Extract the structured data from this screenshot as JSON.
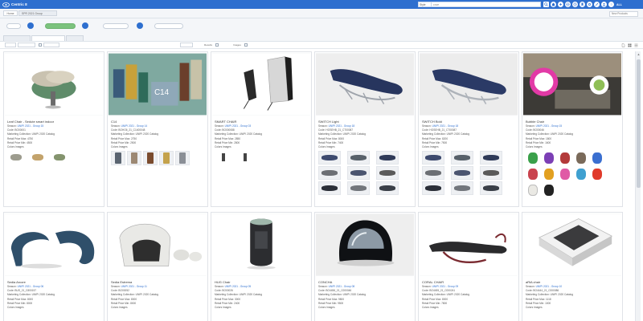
{
  "app": {
    "title": "Centric 8"
  },
  "header": {
    "style_select": "Style",
    "search_value": "cove",
    "all_label": "ALL"
  },
  "tabs": {
    "home": "Home",
    "crumb": "SPR 2021 Group"
  },
  "sub_search_placeholder": "New Products",
  "actions": {
    "pill1": "",
    "pill2": "",
    "pill3": ""
  },
  "view_tabs": [
    "",
    "",
    ""
  ],
  "filter": {
    "sel1": "",
    "sel2": "",
    "sel3": "",
    "sel4": "",
    "label_results": "Results",
    "label_images": "Images"
  },
  "cards": [
    {
      "title": "Leaf Chair - Sedute smart indoor",
      "season": "UNIPI 2021 - Group 15",
      "code": "BO00001",
      "marketing": "UNIPI 2020 Catalog",
      "price_max": "4750",
      "price_min": "4500",
      "thumbs_label": "Colors Images"
    },
    {
      "title": "C14",
      "season": "UNIPI 2021 - Group 14",
      "code": "BOHO6_21_C1400048",
      "marketing": "UNIPI 2020 Catalog",
      "price_max": "2750",
      "price_min": "2500",
      "thumbs_label": "Colors Images"
    },
    {
      "title": "SMART CHAIR",
      "season": "UNIPI 2021 - Group 03",
      "code": "BO000088",
      "marketing": "UNIPI 2020 Catalog",
      "price_max": "2850",
      "price_min": "2800",
      "thumbs_label": "Colors Images"
    },
    {
      "title": "SWITCH Light",
      "season": "UNIPI 2021 - Group 18",
      "code": "HOSEHB_21_CT00087",
      "marketing": "UNIPI 2020 Catalog",
      "price_max": "8000",
      "price_min": "7400",
      "thumbs_label": "Colors Images"
    },
    {
      "title": "SWITCH Bold",
      "season": "UNIPI 2021 - Group 18",
      "code": "HOSEHB_21_CT00087",
      "marketing": "UNIPI 2020 Catalog",
      "price_max": "8200",
      "price_min": "7500",
      "thumbs_label": "Colors Images"
    },
    {
      "title": "Bubble Chair",
      "season": "UNIPI 2021 - Group 15",
      "code": "BO00046",
      "marketing": "UNIPI 2020 Catalog",
      "price_max": "1800",
      "price_min": "1600",
      "thumbs_label": "Colors Images"
    },
    {
      "title": "Sedia Arcore",
      "season": "UNIPI 2021 - Group 06",
      "code": "BUS_21_C800157",
      "marketing": "UNIPI 2020 Catalog",
      "price_max": "8000",
      "price_min": "8000",
      "thumbs_label": "Colors Images"
    },
    {
      "title": "Sedia Estrema",
      "season": "UNIPI 2021 - Group 11",
      "code": "BO00052",
      "marketing": "UNIPI 2020 Catalog",
      "price_max": "8000",
      "price_min": "8000",
      "thumbs_label": "Colors Images"
    },
    {
      "title": "HUG Chair",
      "season": "UNIPI 2021 - Group 05",
      "code": "BO00026",
      "marketing": "UNIPI 2020 Catalog",
      "price_max": "3000",
      "price_min": "2400",
      "thumbs_label": "Colors Images"
    },
    {
      "title": "CONCHA",
      "season": "UNIPI 2021 - Group 08",
      "code": "BO4456_21_C000046",
      "marketing": "UNIPI 2020 Catalog",
      "price_max": "9800",
      "price_min": "9500",
      "thumbs_label": "Colors Images"
    },
    {
      "title": "CORAL CHAIR",
      "season": "UNIPI 2021 - Group 09",
      "code": "BO4455_21_C000241",
      "marketing": "UNIPI 2020 Catalog",
      "price_max": "8000",
      "price_min": "7800",
      "thumbs_label": "Colors Images"
    },
    {
      "title": "aRiA chair",
      "season": "UNIPI 2021 - Group 10",
      "code": "BO4444_21_C000086",
      "marketing": "UNIPI 2020 Catalog",
      "price_max": "1118",
      "price_min": "1000",
      "thumbs_label": "Colors Images"
    }
  ],
  "labels": {
    "season": "Season",
    "code": "Code",
    "marketing": "Marketing Collection",
    "price_max": "Retail Price Max",
    "price_min": "Retail Price Min"
  },
  "colors": {
    "brand_blue": "#2e6fcf",
    "accent_green": "#7cc37e"
  }
}
